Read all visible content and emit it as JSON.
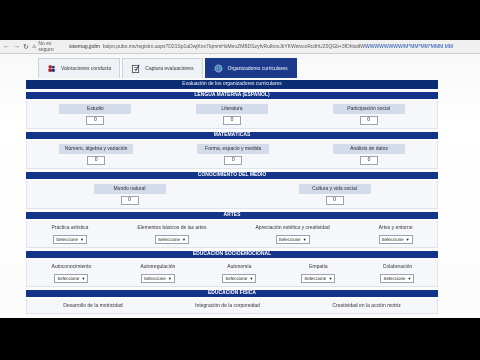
{
  "browser": {
    "insecure_label": "No es seguro",
    "url_prefix": "sisemag.jpdm",
    "url_text": "bsipo.pubo.mx/registro.aspx?D21Sp1aDwjKnx7IqmmHsMeoZMBDSzyfvRuIboxJkYKWeivcoRcdhUZ0QGb+3fDhlsdtW",
    "url_tail": "WWWWWWWW/M*MM*MM*MMM.MM"
  },
  "tabs": [
    {
      "label": "Valoraciones conducta",
      "icon": "users-icon"
    },
    {
      "label": "Captura evaluaciones",
      "icon": "clipboard-icon"
    },
    {
      "label": "Organizadores curriculares",
      "icon": "globe-icon",
      "active": true
    }
  ],
  "page_title": "Evaluación de los organizadores curriculares",
  "sections": {
    "lengua": {
      "title": "LENGUA MATERNA (ESPAÑOL)",
      "fields": [
        {
          "label": "Estudio",
          "value": "0"
        },
        {
          "label": "Literatura",
          "value": "0"
        },
        {
          "label": "Participación social",
          "value": "0"
        }
      ]
    },
    "matematicas": {
      "title": "MATEMÁTICAS",
      "fields": [
        {
          "label": "Número, álgebra y variación",
          "value": "0"
        },
        {
          "label": "Forma, espacio y medida",
          "value": "0"
        },
        {
          "label": "Análisis de datos",
          "value": "0"
        }
      ]
    },
    "medio": {
      "title": "CONOCIMIENTO DEL MEDIO",
      "fields": [
        {
          "label": "Mundo natural",
          "value": "0"
        },
        {
          "label": "Cultura y vida social",
          "value": "0"
        }
      ]
    },
    "artes": {
      "title": "ARTES",
      "fields": [
        {
          "label": "Práctica artística",
          "value": "Seleccione"
        },
        {
          "label": "Elementos básicos de las artes",
          "value": "Seleccione"
        },
        {
          "label": "Apreciación estética y creatividad",
          "value": "Seleccione"
        },
        {
          "label": "Artes y entorno",
          "value": "Seleccione"
        }
      ]
    },
    "socio": {
      "title": "EDUCACIÓN SOCIOEMOCIONAL",
      "fields": [
        {
          "label": "Autoconocimiento",
          "value": "Seleccione"
        },
        {
          "label": "Autorregulación",
          "value": "Seleccione"
        },
        {
          "label": "Autonomía",
          "value": "Seleccione"
        },
        {
          "label": "Empatía",
          "value": "Seleccione"
        },
        {
          "label": "Colaboración",
          "value": "Seleccione"
        }
      ]
    },
    "fisica": {
      "title": "EDUCACIÓN FÍSICA",
      "fields": [
        {
          "label": "Desarrollo de la motricidad"
        },
        {
          "label": "Integración de la corporeidad"
        },
        {
          "label": "Creatividad en la acción motriz"
        }
      ]
    }
  }
}
